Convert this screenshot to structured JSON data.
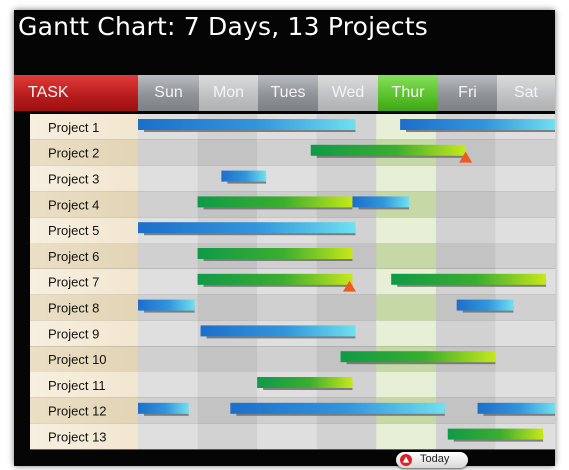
{
  "title": "Gantt Chart: 7 Days, 13 Projects",
  "legend": {
    "today_label": "Today"
  },
  "colors": {
    "task_header": "#c52222",
    "today_column": "#5cc22d",
    "blue_bar": "#1e78d0",
    "green_bar": "#18a040",
    "milestone": "#f05a1e"
  },
  "chart_data": {
    "type": "gantt",
    "title": "Gantt Chart: 7 Days, 13 Projects",
    "task_header": "TASK",
    "days": [
      "Sun",
      "Mon",
      "Tues",
      "Wed",
      "Thur",
      "Fri",
      "Sat"
    ],
    "today": "Thur",
    "time_unit": "day index (0 = start of Sun, 7 = end of Sat)",
    "tasks": [
      {
        "name": "Project 1",
        "bars": [
          {
            "start": 0.0,
            "end": 3.65,
            "color": "blue"
          },
          {
            "start": 4.4,
            "end": 7.0,
            "color": "blue"
          }
        ]
      },
      {
        "name": "Project 2",
        "bars": [
          {
            "start": 2.9,
            "end": 5.5,
            "color": "green"
          }
        ],
        "milestones": [
          5.5
        ]
      },
      {
        "name": "Project 3",
        "bars": [
          {
            "start": 1.4,
            "end": 2.15,
            "color": "blue"
          }
        ]
      },
      {
        "name": "Project 4",
        "bars": [
          {
            "start": 1.0,
            "end": 3.6,
            "color": "green"
          },
          {
            "start": 3.6,
            "end": 4.55,
            "color": "blue"
          }
        ]
      },
      {
        "name": "Project 5",
        "bars": [
          {
            "start": 0.0,
            "end": 3.65,
            "color": "blue"
          }
        ]
      },
      {
        "name": "Project 6",
        "bars": [
          {
            "start": 1.0,
            "end": 3.6,
            "color": "green"
          }
        ]
      },
      {
        "name": "Project 7",
        "bars": [
          {
            "start": 1.0,
            "end": 3.6,
            "color": "green"
          },
          {
            "start": 4.25,
            "end": 6.85,
            "color": "green"
          }
        ],
        "milestones": [
          3.55
        ]
      },
      {
        "name": "Project 8",
        "bars": [
          {
            "start": 0.0,
            "end": 0.95,
            "color": "blue"
          },
          {
            "start": 5.35,
            "end": 6.3,
            "color": "blue"
          }
        ]
      },
      {
        "name": "Project 9",
        "bars": [
          {
            "start": 1.05,
            "end": 3.65,
            "color": "blue"
          }
        ]
      },
      {
        "name": "Project 10",
        "bars": [
          {
            "start": 3.4,
            "end": 6.0,
            "color": "green"
          }
        ]
      },
      {
        "name": "Project 11",
        "bars": [
          {
            "start": 2.0,
            "end": 3.6,
            "color": "green"
          }
        ]
      },
      {
        "name": "Project 12",
        "bars": [
          {
            "start": 0.0,
            "end": 0.85,
            "color": "blue"
          },
          {
            "start": 1.55,
            "end": 5.15,
            "color": "blue"
          },
          {
            "start": 5.7,
            "end": 7.0,
            "color": "blue"
          }
        ]
      },
      {
        "name": "Project 13",
        "bars": [
          {
            "start": 5.2,
            "end": 6.8,
            "color": "green"
          }
        ]
      }
    ]
  }
}
